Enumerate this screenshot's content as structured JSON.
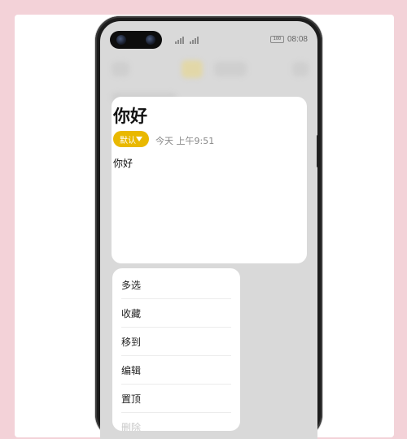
{
  "status_bar": {
    "time": "08:08",
    "battery": "100"
  },
  "note": {
    "title": "你好",
    "category": "默认",
    "timestamp": "今天 上午9:51",
    "body": "你好"
  },
  "context_menu": {
    "items": [
      {
        "label": "多选"
      },
      {
        "label": "收藏"
      },
      {
        "label": "移到"
      },
      {
        "label": "编辑"
      },
      {
        "label": "置顶"
      },
      {
        "label": "删除"
      }
    ]
  },
  "colors": {
    "accent": "#e9b800",
    "page_background": "#f3d2d8"
  }
}
